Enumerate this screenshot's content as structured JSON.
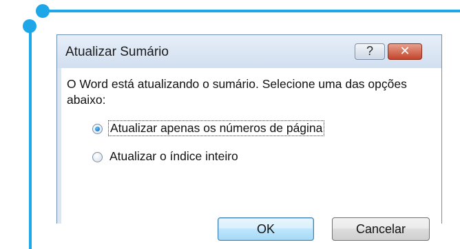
{
  "dialog": {
    "title": "Atualizar Sumário",
    "help_glyph": "?",
    "close_glyph": "✕",
    "message": "O Word está atualizando o sumário. Selecione uma das opções abaixo:",
    "options": [
      {
        "label": "Atualizar apenas os números de página",
        "selected": true
      },
      {
        "label": "Atualizar o índice inteiro",
        "selected": false
      }
    ],
    "ok_label": "OK",
    "cancel_label": "Cancelar"
  },
  "colors": {
    "decoration": "#1ea7e8",
    "dialog_frame": "#dbe6f1",
    "ok_border": "#3c7fb1",
    "close_button": "#c2452a"
  }
}
